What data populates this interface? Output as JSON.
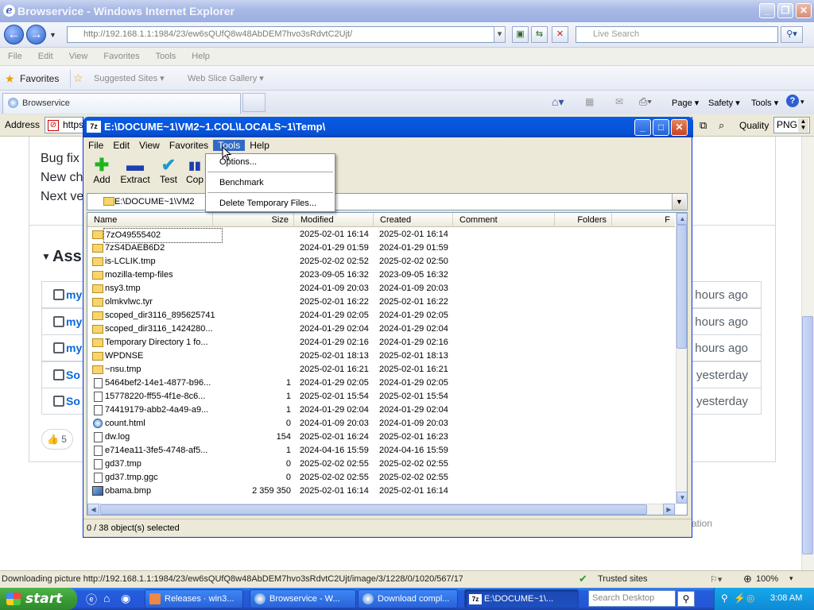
{
  "ie": {
    "title": "Browservice - Windows Internet Explorer",
    "address": "http://192.168.1.1:1984/23/ew6sQUfQ8w48AbDEM7hvo3sRdvtC2Ujt/",
    "address_host": "192.168.1.1",
    "search_placeholder": "Live Search",
    "menu": [
      "File",
      "Edit",
      "View",
      "Favorites",
      "Tools",
      "Help"
    ],
    "favorites_label": "Favorites",
    "fav_items": [
      "Suggested Sites ▾",
      "Web Slice Gallery ▾"
    ],
    "tab_label": "Browservice",
    "cmd_items": [
      "Page ▾",
      "Safety ▾",
      "Tools ▾"
    ],
    "address_label": "Address",
    "address_strip": "https",
    "quality_label": "Quality",
    "quality_value": "PNG",
    "status_text": "Downloading picture http://192.168.1.1:1984/23/ew6sQUfQ8w48AbDEM7hvo3sRdvtC2Ujt/image/3/1228/0/1020/567/17",
    "zone": "Trusted sites",
    "zoom": "100%"
  },
  "webpage": {
    "lines": [
      "Bug fix",
      "New ch",
      "Next ve"
    ],
    "section_title": "Ass",
    "rows": [
      {
        "link": "my",
        "ago": "hours ago"
      },
      {
        "link": "my",
        "ago": "hours ago"
      },
      {
        "link": "my",
        "ago": "hours ago"
      },
      {
        "link": "So",
        "ago": "yesterday"
      },
      {
        "link": "So",
        "ago": "yesterday"
      }
    ],
    "reaction": "👍 5",
    "trailing": "ation"
  },
  "zip": {
    "title": "E:\\DOCUME~1\\VM2~1.COL\\LOCALS~1\\Temp\\",
    "menu": [
      "File",
      "Edit",
      "View",
      "Favorites",
      "Tools",
      "Help"
    ],
    "toolbar": [
      {
        "label": "Add",
        "icon": "plus-icon"
      },
      {
        "label": "Extract",
        "icon": "minus-icon"
      },
      {
        "label": "Test",
        "icon": "check-icon"
      },
      {
        "label": "Cop",
        "icon": "copy-icon"
      }
    ],
    "path": "E:\\DOCUME~1\\VM2",
    "columns": [
      "Name",
      "Size",
      "Modified",
      "Created",
      "Comment",
      "Folders",
      "F"
    ],
    "files": [
      {
        "name": "7zO49555402",
        "size": "",
        "modified": "2025-02-01 16:14",
        "created": "2025-02-01 16:14",
        "type": "folder"
      },
      {
        "name": "7zS4DAEB6D2",
        "size": "",
        "modified": "2024-01-29 01:59",
        "created": "2024-01-29 01:59",
        "type": "folder"
      },
      {
        "name": "is-LCLIK.tmp",
        "size": "",
        "modified": "2025-02-02 02:52",
        "created": "2025-02-02 02:50",
        "type": "folder"
      },
      {
        "name": "mozilla-temp-files",
        "size": "",
        "modified": "2023-09-05 16:32",
        "created": "2023-09-05 16:32",
        "type": "folder"
      },
      {
        "name": "nsy3.tmp",
        "size": "",
        "modified": "2024-01-09 20:03",
        "created": "2024-01-09 20:03",
        "type": "folder"
      },
      {
        "name": "olmkvlwc.tyr",
        "size": "",
        "modified": "2025-02-01 16:22",
        "created": "2025-02-01 16:22",
        "type": "folder"
      },
      {
        "name": "scoped_dir3116_895625741",
        "size": "",
        "modified": "2024-01-29 02:05",
        "created": "2024-01-29 02:05",
        "type": "folder"
      },
      {
        "name": "scoped_dir3116_1424280...",
        "size": "",
        "modified": "2024-01-29 02:04",
        "created": "2024-01-29 02:04",
        "type": "folder"
      },
      {
        "name": "Temporary Directory 1 fo...",
        "size": "",
        "modified": "2024-01-29 02:16",
        "created": "2024-01-29 02:16",
        "type": "folder"
      },
      {
        "name": "WPDNSE",
        "size": "",
        "modified": "2025-02-01 18:13",
        "created": "2025-02-01 18:13",
        "type": "folder"
      },
      {
        "name": "~nsu.tmp",
        "size": "",
        "modified": "2025-02-01 16:21",
        "created": "2025-02-01 16:21",
        "type": "folder"
      },
      {
        "name": "5464bef2-14e1-4877-b96...",
        "size": "1",
        "modified": "2024-01-29 02:05",
        "created": "2024-01-29 02:05",
        "type": "file"
      },
      {
        "name": "15778220-ff55-4f1e-8c6...",
        "size": "1",
        "modified": "2025-02-01 15:54",
        "created": "2025-02-01 15:54",
        "type": "file"
      },
      {
        "name": "74419179-abb2-4a49-a9...",
        "size": "1",
        "modified": "2024-01-29 02:04",
        "created": "2024-01-29 02:04",
        "type": "file"
      },
      {
        "name": "count.html",
        "size": "0",
        "modified": "2024-01-09 20:03",
        "created": "2024-01-09 20:03",
        "type": "ie"
      },
      {
        "name": "dw.log",
        "size": "154",
        "modified": "2025-02-01 16:24",
        "created": "2025-02-01 16:23",
        "type": "file"
      },
      {
        "name": "e714ea11-3fe5-4748-af5...",
        "size": "1",
        "modified": "2024-04-16 15:59",
        "created": "2024-04-16 15:59",
        "type": "file"
      },
      {
        "name": "gd37.tmp",
        "size": "0",
        "modified": "2025-02-02 02:55",
        "created": "2025-02-02 02:55",
        "type": "file"
      },
      {
        "name": "gd37.tmp.ggc",
        "size": "0",
        "modified": "2025-02-02 02:55",
        "created": "2025-02-02 02:55",
        "type": "file"
      },
      {
        "name": "obama.bmp",
        "size": "2 359 350",
        "modified": "2025-02-01 16:14",
        "created": "2025-02-01 16:14",
        "type": "bmp"
      }
    ],
    "status": "0 / 38 object(s) selected",
    "tools_menu": [
      "Options...",
      "Benchmark",
      "Delete Temporary Files..."
    ]
  },
  "taskbar": {
    "start": "start",
    "tasks": [
      "Releases · win3...",
      "Browservice - W...",
      "Download compl...",
      "E:\\DOCUME~1\\..."
    ],
    "search_placeholder": "Search Desktop",
    "clock": "3:08 AM"
  }
}
